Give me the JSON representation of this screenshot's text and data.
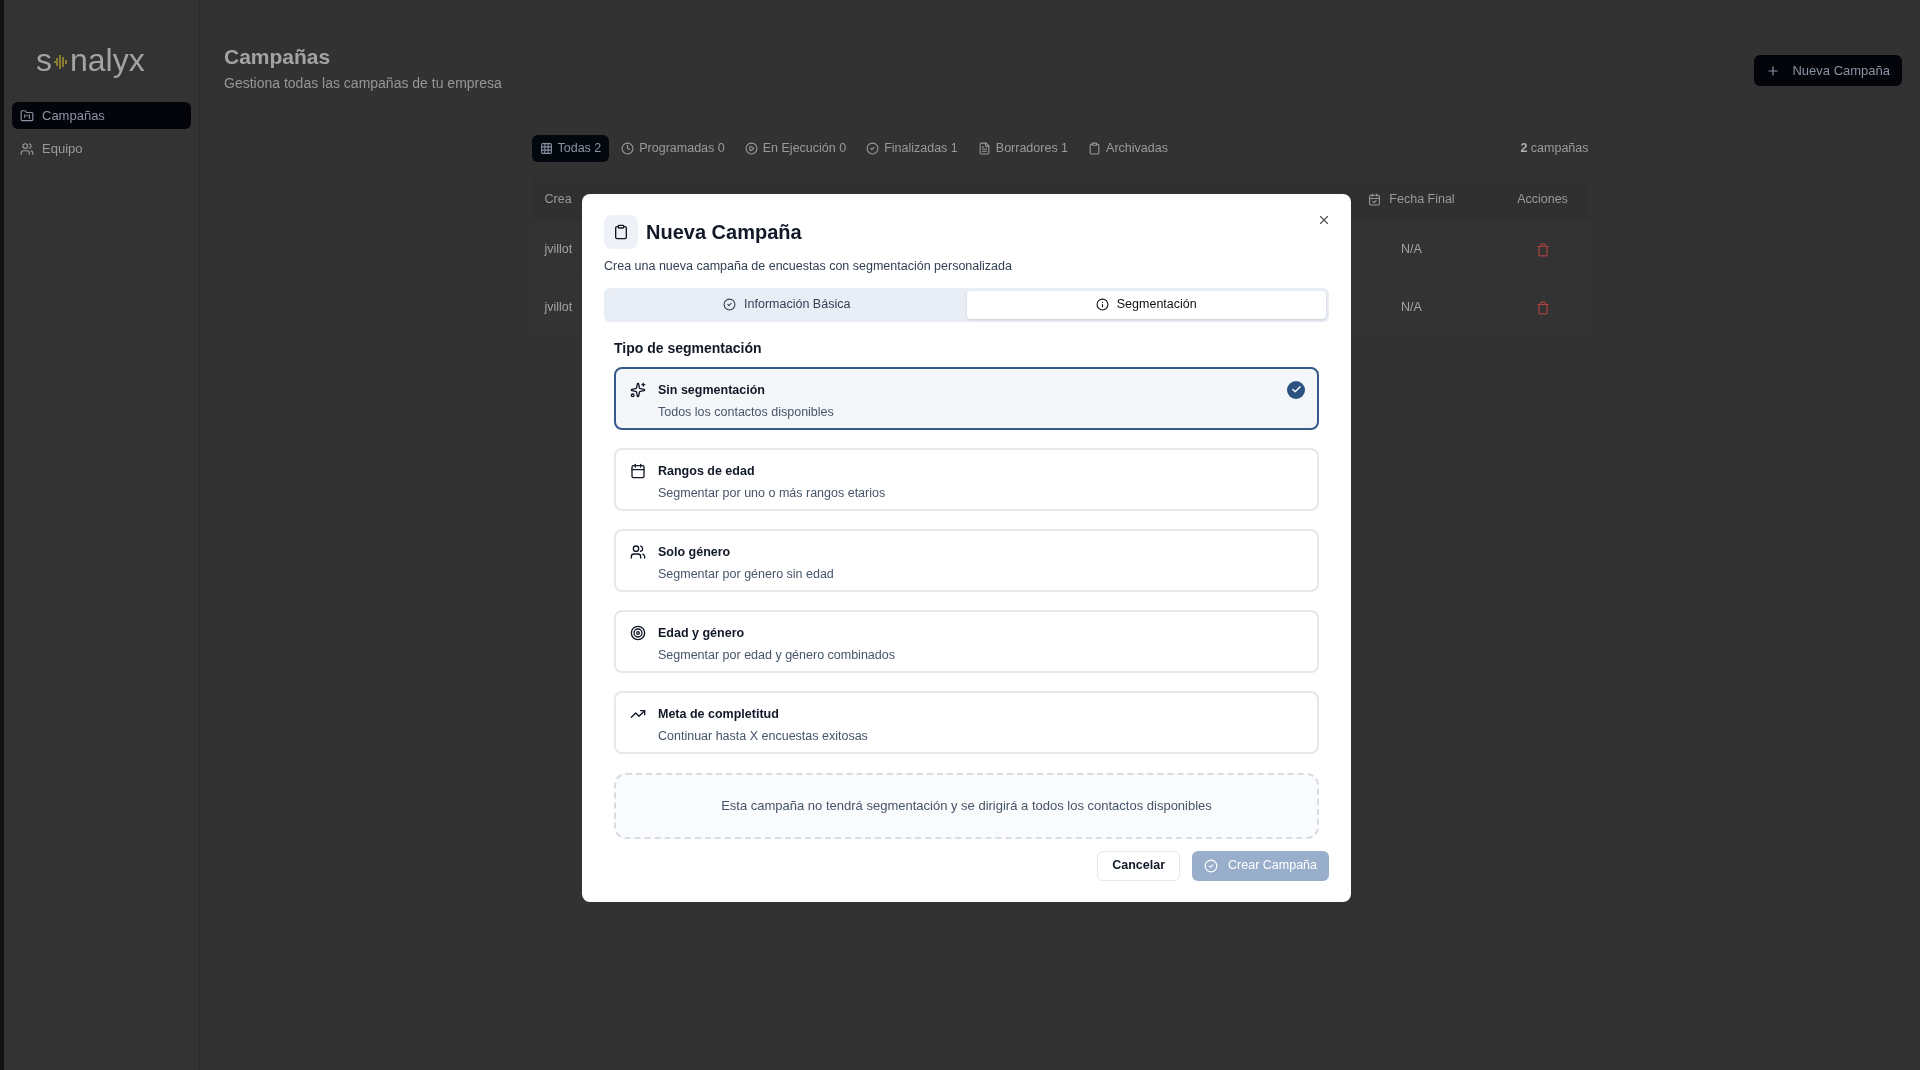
{
  "sidebar": {
    "logo": {
      "prefix": "s",
      "suffix": "nalyx"
    },
    "items": [
      {
        "label": "Campañas",
        "selected": true
      },
      {
        "label": "Equipo",
        "selected": false
      }
    ]
  },
  "header": {
    "title": "Campañas",
    "subtitle": "Gestiona todas las campañas de tu empresa",
    "button": "Nueva Campaña"
  },
  "filters": {
    "tabs": [
      {
        "label": "Todas 2",
        "selected": true
      },
      {
        "label": "Programadas 0",
        "selected": false
      },
      {
        "label": "En Ejecución 0",
        "selected": false
      },
      {
        "label": "Finalizadas 1",
        "selected": false
      },
      {
        "label": "Borradores 1",
        "selected": false
      },
      {
        "label": "Archivadas",
        "selected": false
      }
    ],
    "count": {
      "number": "2",
      "label": "campañas"
    }
  },
  "table": {
    "columns": [
      "Crea",
      "Fecha Final",
      "Acciones"
    ],
    "rows": [
      {
        "column_1": "jvillot",
        "fecha_final": "N/A"
      },
      {
        "column_1": "jvillot",
        "fecha_final": "N/A"
      }
    ]
  },
  "modal": {
    "title": "Nueva Campaña",
    "subtitle": "Crea una nueva campaña de encuestas con segmentación personalizada",
    "tabs": [
      {
        "label": "Información Básica",
        "selected": false
      },
      {
        "label": "Segmentación",
        "selected": true
      }
    ],
    "section_title": "Tipo de segmentación",
    "options": [
      {
        "title": "Sin segmentación",
        "description": "Todos los contactos disponibles",
        "selected": true
      },
      {
        "title": "Rangos de edad",
        "description": "Segmentar por uno o más rangos etarios",
        "selected": false
      },
      {
        "title": "Solo género",
        "description": "Segmentar por género sin edad",
        "selected": false
      },
      {
        "title": "Edad y género",
        "description": "Segmentar por edad y género combinados",
        "selected": false
      },
      {
        "title": "Meta de completitud",
        "description": "Continuar hasta X encuestas exitosas",
        "selected": false
      }
    ],
    "info": "Esta campaña no tendrá segmentación y se dirigirá a todos los contactos disponibles",
    "buttons": {
      "cancel": {
        "label": "Cancelar"
      },
      "create": {
        "label": "Crear Campaña",
        "disabled": true
      }
    }
  }
}
